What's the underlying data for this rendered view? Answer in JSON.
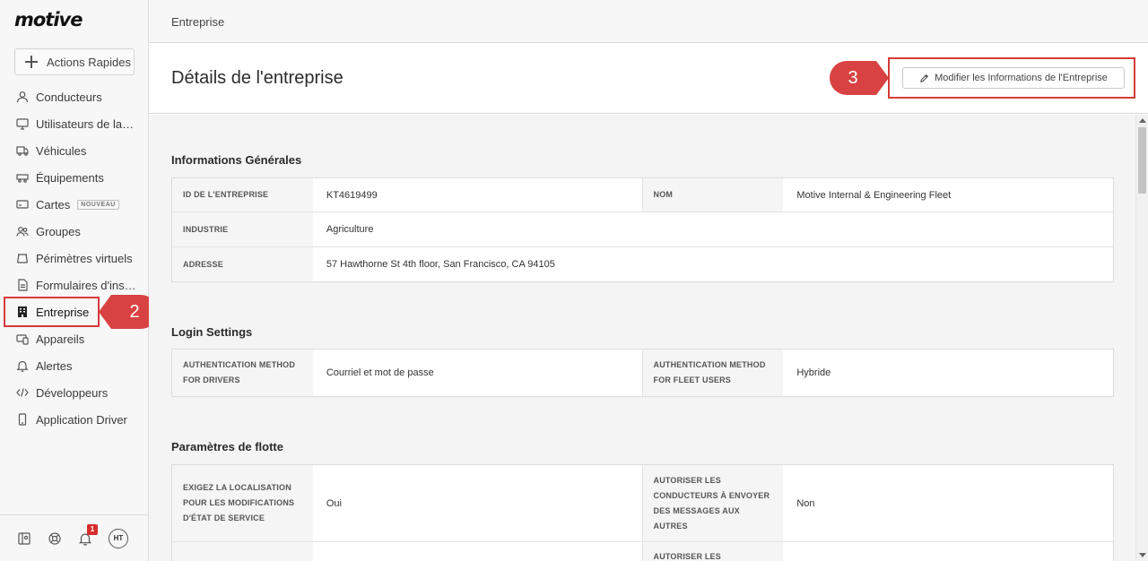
{
  "app": {
    "logo": "motive"
  },
  "sidebar": {
    "quick_actions": "Actions Rapides",
    "items": [
      {
        "label": "Conducteurs",
        "icon": "user-icon"
      },
      {
        "label": "Utilisateurs de la flotte",
        "icon": "monitor-icon"
      },
      {
        "label": "Véhicules",
        "icon": "truck-icon"
      },
      {
        "label": "Équipements",
        "icon": "trailer-icon"
      },
      {
        "label": "Cartes",
        "icon": "card-icon",
        "badge": "NOUVEAU"
      },
      {
        "label": "Groupes",
        "icon": "users-icon"
      },
      {
        "label": "Périmètres virtuels",
        "icon": "geofence-icon"
      },
      {
        "label": "Formulaires d'inspection",
        "icon": "form-icon"
      },
      {
        "label": "Entreprise",
        "icon": "building-icon",
        "active": true
      },
      {
        "label": "Appareils",
        "icon": "devices-icon"
      },
      {
        "label": "Alertes",
        "icon": "bell-icon"
      },
      {
        "label": "Développeurs",
        "icon": "code-icon"
      },
      {
        "label": "Application Driver",
        "icon": "phone-icon"
      }
    ],
    "footer": {
      "notification_count": "1",
      "avatar_initials": "HT"
    }
  },
  "callouts": {
    "step2": "2",
    "step3": "3"
  },
  "topbar": {
    "breadcrumb": "Entreprise"
  },
  "header": {
    "title": "Détails de l'entreprise",
    "edit_button": "Modifier les Informations de l'Entreprise"
  },
  "sections": {
    "general": {
      "title": "Informations Générales",
      "company_id_label": "ID DE L'ENTREPRISE",
      "company_id": "KT4619499",
      "name_label": "NOM",
      "name": "Motive Internal & Engineering Fleet",
      "industry_label": "INDUSTRIE",
      "industry": "Agriculture",
      "address_label": "ADRESSE",
      "address": "57 Hawthorne St 4th floor, San Francisco, CA 94105"
    },
    "login": {
      "title": "Login Settings",
      "drivers_label": "AUTHENTICATION METHOD FOR DRIVERS",
      "drivers_value": "Courriel et mot de passe",
      "fleet_label": "AUTHENTICATION METHOD FOR FLEET USERS",
      "fleet_value": "Hybride"
    },
    "fleet": {
      "title": "Paramètres de flotte",
      "location_label": "EXIGEZ LA LOCALISATION POUR LES MODIFICATIONS D'ÉTAT DE SERVICE",
      "location_value": "Oui",
      "messages_label": "AUTORISER LES CONDUCTEURS À ENVOYER DES MESSAGES AUX AUTRES",
      "messages_value": "Non",
      "next_label_right": "AUTORISER LES"
    }
  }
}
